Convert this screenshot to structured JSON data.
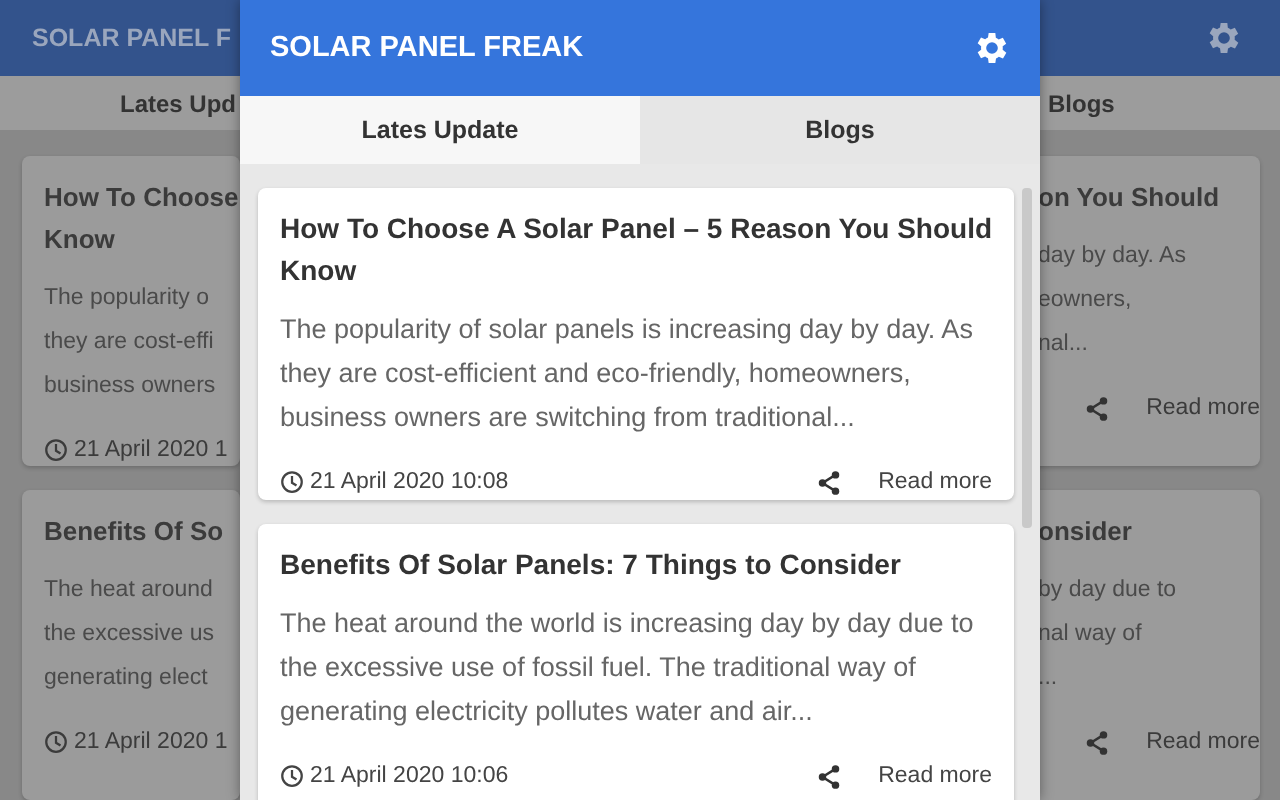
{
  "background": {
    "left": {
      "brand": "SOLAR PANEL F",
      "tab": "Lates Upd",
      "cards": [
        {
          "title_lines": [
            "How To Choose",
            "Know"
          ],
          "body_lines": [
            "The popularity o",
            "they are cost-effi",
            "business owners"
          ],
          "date": "21 April 2020 1"
        },
        {
          "title_lines": [
            "Benefits Of So"
          ],
          "body_lines": [
            "The heat around",
            "the excessive us",
            "generating elect"
          ],
          "date": "21 April 2020 1"
        }
      ]
    },
    "right": {
      "tab": "Blogs",
      "cards": [
        {
          "title_lines": [
            "on You Should"
          ],
          "body_lines": [
            "day by day. As",
            "eowners,",
            "nal..."
          ],
          "read_more": "Read more"
        },
        {
          "title_lines": [
            "onsider"
          ],
          "body_lines": [
            "by day due to",
            "nal way of",
            "..."
          ],
          "read_more": "Read more"
        }
      ]
    }
  },
  "popup": {
    "brand": "SOLAR PANEL FREAK",
    "tabs": [
      {
        "label": "Lates Update",
        "selected": true
      },
      {
        "label": "Blogs",
        "selected": false
      }
    ],
    "posts": [
      {
        "title": "How To Choose A Solar Panel – 5 Reason You Should Know",
        "excerpt": "The popularity of solar panels is increasing day by day. As they are cost-efficient and eco-friendly, homeowners, business owners are switching from traditional...",
        "date": "21 April 2020 10:08",
        "read_more": "Read more"
      },
      {
        "title": "Benefits Of Solar Panels: 7 Things to Consider",
        "excerpt": "The heat around the world is increasing day by day due to the excessive use of fossil fuel. The traditional way of generating electricity pollutes water and air...",
        "date": "21 April 2020 10:06",
        "read_more": "Read more"
      }
    ]
  }
}
